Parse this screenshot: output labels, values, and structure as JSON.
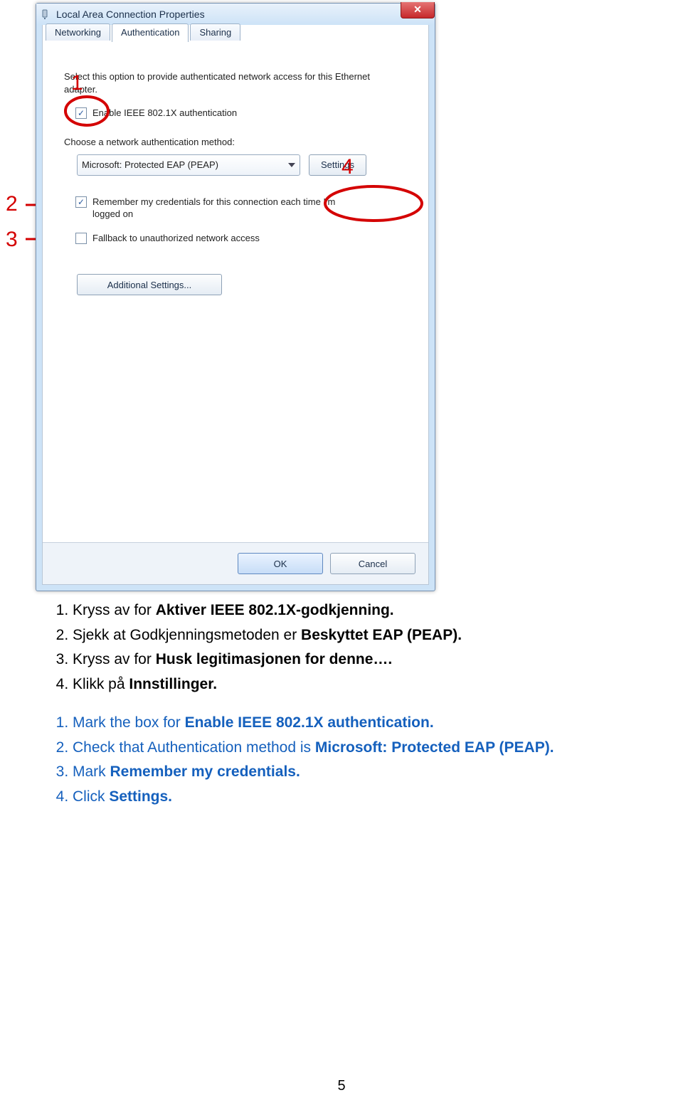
{
  "dialog": {
    "title": "Local Area Connection Properties",
    "tabs": [
      "Networking",
      "Authentication",
      "Sharing"
    ],
    "active_tab": 1,
    "desc": "Select this option to provide authenticated network access for this Ethernet adapter.",
    "chk_enable_label": "Enable IEEE 802.1X authentication",
    "chk_enable_checked": true,
    "method_label": "Choose a network authentication method:",
    "method_value": "Microsoft: Protected EAP (PEAP)",
    "settings_btn": "Settings",
    "chk_remember_label": "Remember my credentials for this connection each time I'm logged on",
    "chk_remember_checked": true,
    "chk_fallback_label": "Fallback to unauthorized network access",
    "chk_fallback_checked": false,
    "additional_btn": "Additional Settings...",
    "ok": "OK",
    "cancel": "Cancel"
  },
  "annotations": {
    "n1": "1",
    "n2": "2",
    "n3": "3",
    "n4": "4"
  },
  "doc": {
    "no": [
      {
        "pre": "Kryss av for ",
        "bold": "Aktiver IEEE 802.1X-godkjenning."
      },
      {
        "pre": "Sjekk at Godkjenningsmetoden er ",
        "bold": "Beskyttet EAP (PEAP)."
      },
      {
        "pre": "Kryss av for ",
        "bold": "Husk legitimasjonen for denne…."
      },
      {
        "pre": "Klikk på ",
        "bold": "Innstillinger."
      }
    ],
    "en": [
      {
        "pre": "Mark the box for ",
        "bold": "Enable IEEE 802.1X authentication."
      },
      {
        "pre": "Check that Authentication method is ",
        "bold": "Microsoft: Protected EAP (PEAP)."
      },
      {
        "pre": "Mark ",
        "bold": "Remember my credentials."
      },
      {
        "pre": "Click ",
        "bold": "Settings."
      }
    ]
  },
  "page_number": "5"
}
